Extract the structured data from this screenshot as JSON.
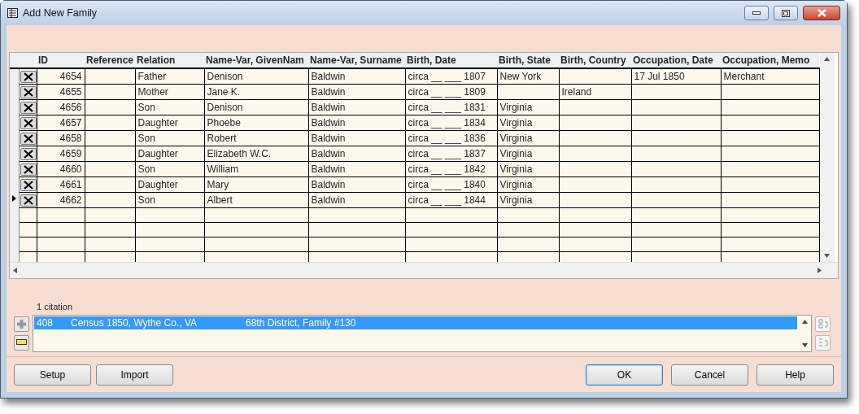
{
  "window": {
    "title": "Add New Family"
  },
  "table": {
    "columns": [
      "ID",
      "Reference",
      "Relation",
      "Name-Var, GivenNam",
      "Name-Var, Surname",
      "Birth, Date",
      "Birth, State",
      "Birth, Country",
      "Occupation, Date",
      "Occupation, Memo"
    ],
    "rows": [
      {
        "current": false,
        "cells": [
          "4654",
          "",
          "Father",
          "Denison",
          "Baldwin",
          "circa __ ___ 1807",
          "New York",
          "",
          "17 Jul 1850",
          "Merchant"
        ]
      },
      {
        "current": false,
        "cells": [
          "4655",
          "",
          "Mother",
          "Jane K.",
          "Baldwin",
          "circa __ ___ 1809",
          "",
          "Ireland",
          "",
          ""
        ]
      },
      {
        "current": false,
        "cells": [
          "4656",
          "",
          "Son",
          "Denison",
          "Baldwin",
          "circa __ ___ 1831",
          "Virginia",
          "",
          "",
          ""
        ]
      },
      {
        "current": false,
        "cells": [
          "4657",
          "",
          "Daughter",
          "Phoebe",
          "Baldwin",
          "circa __ ___ 1834",
          "Virginia",
          "",
          "",
          ""
        ]
      },
      {
        "current": false,
        "cells": [
          "4658",
          "",
          "Son",
          "Robert",
          "Baldwin",
          "circa __ ___ 1836",
          "Virginia",
          "",
          "",
          ""
        ]
      },
      {
        "current": false,
        "cells": [
          "4659",
          "",
          "Daughter",
          "Elizabeth W.C.",
          "Baldwin",
          "circa __ ___ 1837",
          "Virginia",
          "",
          "",
          ""
        ]
      },
      {
        "current": false,
        "cells": [
          "4660",
          "",
          "Son",
          "William",
          "Baldwin",
          "circa __ ___ 1842",
          "Virginia",
          "",
          "",
          ""
        ]
      },
      {
        "current": false,
        "cells": [
          "4661",
          "",
          "Daughter",
          "Mary",
          "Baldwin",
          "circa __ ___ 1840",
          "Virginia",
          "",
          "",
          ""
        ]
      },
      {
        "current": true,
        "cells": [
          "4662",
          "",
          "Son",
          "Albert",
          "Baldwin",
          "circa __ ___ 1844",
          "Virginia",
          "",
          "",
          ""
        ]
      }
    ]
  },
  "citations": {
    "count_label": "1 citation",
    "items": [
      {
        "selected": true,
        "number": "408",
        "source": "Census 1850, Wythe Co., VA",
        "detail": "68th District, Family #130"
      }
    ]
  },
  "buttons_left": [
    "Setup",
    "Import"
  ],
  "buttons_right": [
    {
      "label": "OK",
      "default": true
    },
    {
      "label": "Cancel",
      "default": false
    },
    {
      "label": "Help",
      "default": false
    }
  ]
}
